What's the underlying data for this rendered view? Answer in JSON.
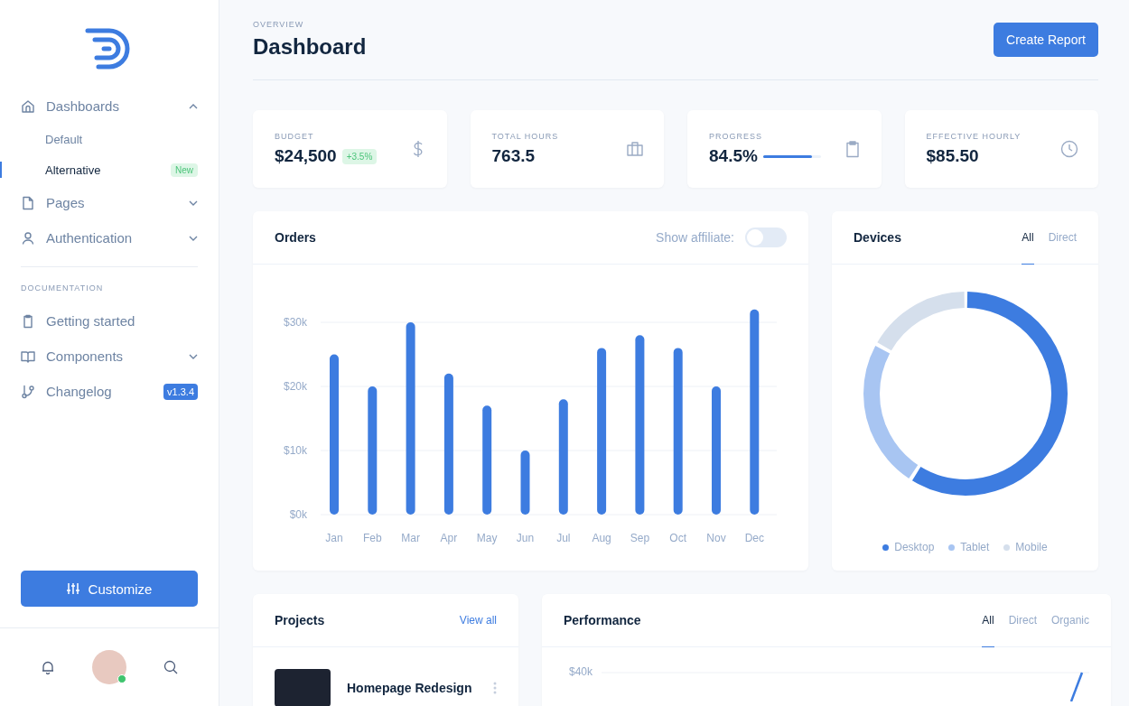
{
  "sidebar": {
    "nav": [
      {
        "label": "Dashboards",
        "kind": "home",
        "expanded": true,
        "children": [
          {
            "label": "Default",
            "selected": false
          },
          {
            "label": "Alternative",
            "selected": true,
            "badge": {
              "text": "New",
              "kind": "new"
            }
          }
        ]
      },
      {
        "label": "Pages",
        "kind": "file",
        "expanded": false
      },
      {
        "label": "Authentication",
        "kind": "user",
        "expanded": false
      }
    ],
    "section_heading": "DOCUMENTATION",
    "docs": [
      {
        "label": "Getting started",
        "kind": "clipboard"
      },
      {
        "label": "Components",
        "kind": "book",
        "expanded": false
      },
      {
        "label": "Changelog",
        "kind": "branch",
        "badge": {
          "text": "v1.3.4",
          "kind": "version"
        }
      }
    ],
    "customize_button": "Customize",
    "user": {
      "online": true
    }
  },
  "header": {
    "pretitle": "OVERVIEW",
    "title": "Dashboard",
    "button": "Create Report"
  },
  "stats": [
    {
      "label": "BUDGET",
      "value": "$24,500",
      "delta": "+3.5%",
      "kind": "dollar"
    },
    {
      "label": "TOTAL HOURS",
      "value": "763.5",
      "kind": "briefcase"
    },
    {
      "label": "PROGRESS",
      "value": "84.5%",
      "level": 0.845,
      "kind": "clipboard"
    },
    {
      "label": "EFFECTIVE HOURLY",
      "value": "$85.50",
      "kind": "clock"
    }
  ],
  "orders": {
    "title": "Orders",
    "toggle": {
      "label": "Show affiliate:",
      "on": false
    },
    "chart_data": {
      "type": "bar",
      "categories": [
        "Jan",
        "Feb",
        "Mar",
        "Apr",
        "May",
        "Jun",
        "Jul",
        "Aug",
        "Sep",
        "Oct",
        "Nov",
        "Dec"
      ],
      "values": [
        25000,
        20000,
        30000,
        22000,
        17000,
        10000,
        18000,
        26000,
        28000,
        26000,
        20000,
        32000
      ],
      "ylim": [
        0,
        32000
      ],
      "grid": true,
      "yticks": [
        {
          "value": 0,
          "label": "$0k"
        },
        {
          "value": 10000,
          "label": "$10k"
        },
        {
          "value": 20000,
          "label": "$20k"
        },
        {
          "value": 30000,
          "label": "$30k"
        }
      ]
    }
  },
  "devices": {
    "title": "Devices",
    "tabs": [
      {
        "label": "All",
        "selected": true
      },
      {
        "label": "Direct",
        "selected": false
      }
    ],
    "legend": [
      {
        "label": "Desktop",
        "color": "#3d7ce0"
      },
      {
        "label": "Tablet",
        "color": "#a8c5f2"
      },
      {
        "label": "Mobile",
        "color": "#d5dfec"
      }
    ]
  },
  "projects": {
    "title": "Projects",
    "link": "View all",
    "items": [
      {
        "name": "Homepage Redesign"
      }
    ]
  },
  "performance": {
    "title": "Performance",
    "tabs": [
      {
        "label": "All",
        "selected": true
      },
      {
        "label": "Direct",
        "selected": false
      },
      {
        "label": "Organic",
        "selected": false
      }
    ],
    "y_label": "$40k"
  }
}
